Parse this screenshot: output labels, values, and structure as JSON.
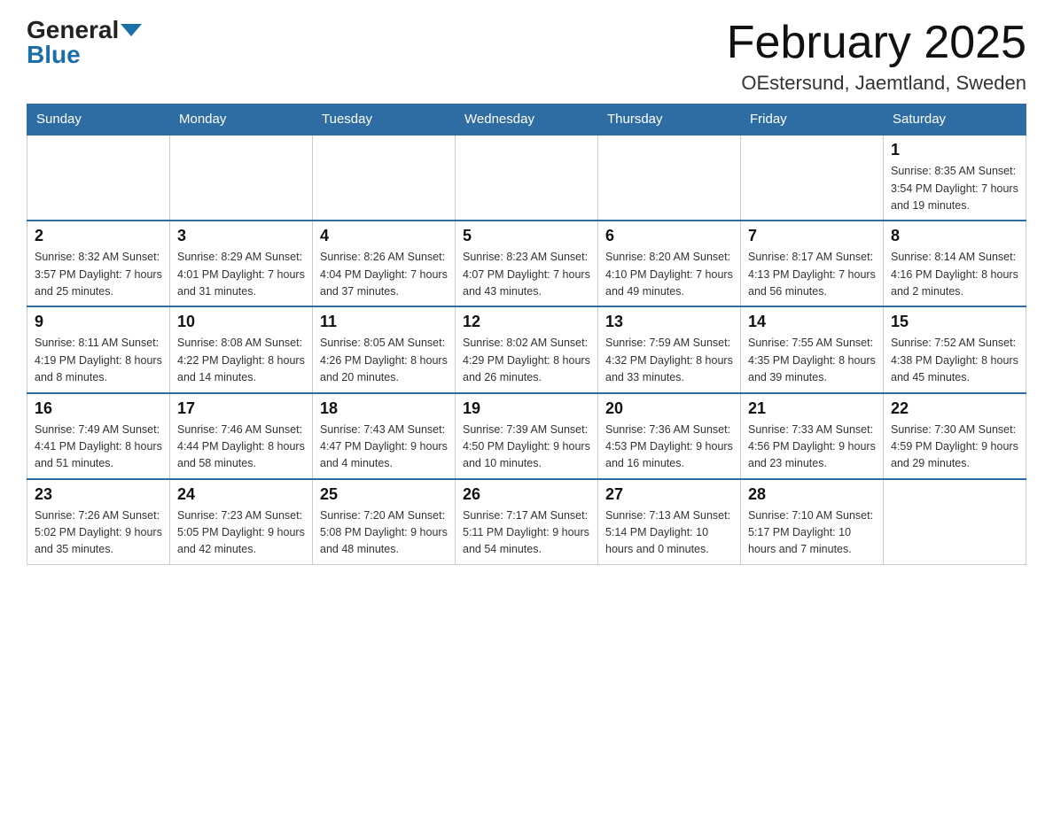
{
  "header": {
    "logo_general": "General",
    "logo_blue": "Blue",
    "month_title": "February 2025",
    "location": "OEstersund, Jaemtland, Sweden"
  },
  "weekdays": [
    "Sunday",
    "Monday",
    "Tuesday",
    "Wednesday",
    "Thursday",
    "Friday",
    "Saturday"
  ],
  "weeks": [
    [
      {
        "day": "",
        "info": ""
      },
      {
        "day": "",
        "info": ""
      },
      {
        "day": "",
        "info": ""
      },
      {
        "day": "",
        "info": ""
      },
      {
        "day": "",
        "info": ""
      },
      {
        "day": "",
        "info": ""
      },
      {
        "day": "1",
        "info": "Sunrise: 8:35 AM\nSunset: 3:54 PM\nDaylight: 7 hours\nand 19 minutes."
      }
    ],
    [
      {
        "day": "2",
        "info": "Sunrise: 8:32 AM\nSunset: 3:57 PM\nDaylight: 7 hours\nand 25 minutes."
      },
      {
        "day": "3",
        "info": "Sunrise: 8:29 AM\nSunset: 4:01 PM\nDaylight: 7 hours\nand 31 minutes."
      },
      {
        "day": "4",
        "info": "Sunrise: 8:26 AM\nSunset: 4:04 PM\nDaylight: 7 hours\nand 37 minutes."
      },
      {
        "day": "5",
        "info": "Sunrise: 8:23 AM\nSunset: 4:07 PM\nDaylight: 7 hours\nand 43 minutes."
      },
      {
        "day": "6",
        "info": "Sunrise: 8:20 AM\nSunset: 4:10 PM\nDaylight: 7 hours\nand 49 minutes."
      },
      {
        "day": "7",
        "info": "Sunrise: 8:17 AM\nSunset: 4:13 PM\nDaylight: 7 hours\nand 56 minutes."
      },
      {
        "day": "8",
        "info": "Sunrise: 8:14 AM\nSunset: 4:16 PM\nDaylight: 8 hours\nand 2 minutes."
      }
    ],
    [
      {
        "day": "9",
        "info": "Sunrise: 8:11 AM\nSunset: 4:19 PM\nDaylight: 8 hours\nand 8 minutes."
      },
      {
        "day": "10",
        "info": "Sunrise: 8:08 AM\nSunset: 4:22 PM\nDaylight: 8 hours\nand 14 minutes."
      },
      {
        "day": "11",
        "info": "Sunrise: 8:05 AM\nSunset: 4:26 PM\nDaylight: 8 hours\nand 20 minutes."
      },
      {
        "day": "12",
        "info": "Sunrise: 8:02 AM\nSunset: 4:29 PM\nDaylight: 8 hours\nand 26 minutes."
      },
      {
        "day": "13",
        "info": "Sunrise: 7:59 AM\nSunset: 4:32 PM\nDaylight: 8 hours\nand 33 minutes."
      },
      {
        "day": "14",
        "info": "Sunrise: 7:55 AM\nSunset: 4:35 PM\nDaylight: 8 hours\nand 39 minutes."
      },
      {
        "day": "15",
        "info": "Sunrise: 7:52 AM\nSunset: 4:38 PM\nDaylight: 8 hours\nand 45 minutes."
      }
    ],
    [
      {
        "day": "16",
        "info": "Sunrise: 7:49 AM\nSunset: 4:41 PM\nDaylight: 8 hours\nand 51 minutes."
      },
      {
        "day": "17",
        "info": "Sunrise: 7:46 AM\nSunset: 4:44 PM\nDaylight: 8 hours\nand 58 minutes."
      },
      {
        "day": "18",
        "info": "Sunrise: 7:43 AM\nSunset: 4:47 PM\nDaylight: 9 hours\nand 4 minutes."
      },
      {
        "day": "19",
        "info": "Sunrise: 7:39 AM\nSunset: 4:50 PM\nDaylight: 9 hours\nand 10 minutes."
      },
      {
        "day": "20",
        "info": "Sunrise: 7:36 AM\nSunset: 4:53 PM\nDaylight: 9 hours\nand 16 minutes."
      },
      {
        "day": "21",
        "info": "Sunrise: 7:33 AM\nSunset: 4:56 PM\nDaylight: 9 hours\nand 23 minutes."
      },
      {
        "day": "22",
        "info": "Sunrise: 7:30 AM\nSunset: 4:59 PM\nDaylight: 9 hours\nand 29 minutes."
      }
    ],
    [
      {
        "day": "23",
        "info": "Sunrise: 7:26 AM\nSunset: 5:02 PM\nDaylight: 9 hours\nand 35 minutes."
      },
      {
        "day": "24",
        "info": "Sunrise: 7:23 AM\nSunset: 5:05 PM\nDaylight: 9 hours\nand 42 minutes."
      },
      {
        "day": "25",
        "info": "Sunrise: 7:20 AM\nSunset: 5:08 PM\nDaylight: 9 hours\nand 48 minutes."
      },
      {
        "day": "26",
        "info": "Sunrise: 7:17 AM\nSunset: 5:11 PM\nDaylight: 9 hours\nand 54 minutes."
      },
      {
        "day": "27",
        "info": "Sunrise: 7:13 AM\nSunset: 5:14 PM\nDaylight: 10 hours\nand 0 minutes."
      },
      {
        "day": "28",
        "info": "Sunrise: 7:10 AM\nSunset: 5:17 PM\nDaylight: 10 hours\nand 7 minutes."
      },
      {
        "day": "",
        "info": ""
      }
    ]
  ]
}
